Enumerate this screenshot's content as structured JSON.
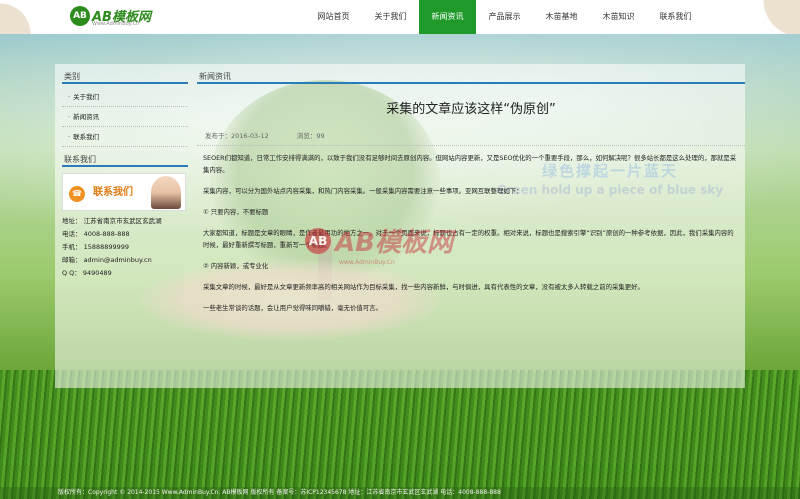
{
  "brand": {
    "logo_badge": "AB",
    "logo_text": "AB模板网",
    "logo_sub": "Www.AdminBuy.Cn"
  },
  "nav": [
    {
      "label": "网站首页",
      "active": false
    },
    {
      "label": "关于我们",
      "active": false
    },
    {
      "label": "新闻资讯",
      "active": true
    },
    {
      "label": "产品展示",
      "active": false
    },
    {
      "label": "木苗基地",
      "active": false
    },
    {
      "label": "木苗知识",
      "active": false
    },
    {
      "label": "联系我们",
      "active": false
    }
  ],
  "sidebar": {
    "category_title": "类别",
    "items": [
      "关于我们",
      "新闻资讯",
      "联系我们"
    ],
    "contact_title": "联系我们",
    "contact_banner": "联系我们",
    "contact_lines": [
      "地址： 江苏省南京市玄武区玄武湖",
      "电话： 4008-888-888",
      "手机： 15888899999",
      "邮箱： admin@adminbuy.cn",
      "Q Q： 9490489"
    ]
  },
  "content": {
    "section_title": "新闻资讯",
    "article_title": "采集的文章应该这样“伪原创”",
    "published": "发布于：2016-03-12",
    "views": "浏览：99",
    "paragraphs": [
      "SEOER们都知道，日常工作安排得满满的，以致于我们没有足够时间去原创内容。但网站内容更新，又是SEO优化的一个重要手段，那么，如何解决呢？很多站长都是这么处理的，那就是采集内容。",
      "采集内容，可以分为国外站点内容采集，和热门内容采集。一般采集内容需要注意一些事项。亚网互联整理如下：",
      "① 只要内容，不要标题",
      "大家都知道，标题是文章的眼睛，是作者最用功的地方之一。对于一个页面来说，标题也占有一定的权重。相对来说，标题也是搜索引擎“识别”原创的一种参考依据，因此，我们采集内容的时候，最好重新撰写标题，重新写一个标题。",
      "② 内容新颖，或专业化",
      "采集文章的时候，最好是从文章更新频率高的相关网站作为目标采集，找一些内容新鲜，与时俱进，具有代表性的文章，没有被太多人转载之前的采集更好。",
      "一些老生常谈的话题，会让用户觉得味同嚼蜡，毫无价值可言。"
    ]
  },
  "background": {
    "slogan_cn": "绿色撑起一片蓝天",
    "slogan_en": "Green hold up a piece of blue sky"
  },
  "watermark": {
    "badge": "AB",
    "text": "AB模板网",
    "sub": "www.AdminBuy.Cn"
  },
  "footer": {
    "text": "版权所有：Copyright © 2014-2015 Www.AdminBuy.Cn. AB模板网 版权所有    备案号：苏ICP12345678    地址：江苏省南京市玄武区玄武湖    电话：4008-888-888"
  },
  "colors": {
    "accent": "#1f9a2a",
    "rule": "#2a7bb8"
  }
}
